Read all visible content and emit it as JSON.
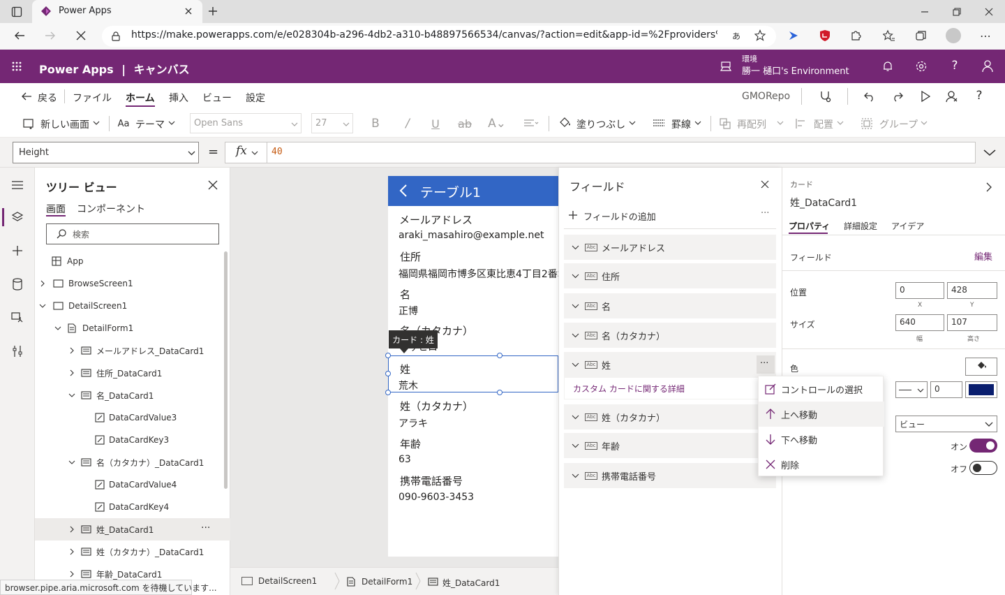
{
  "browser": {
    "tab_title": "Power Apps",
    "url": "https://make.powerapps.com/e/e028304b-a296-4db2-a310-b48897566534/canvas/?action=edit&app-id=%2Fproviders%2FMicrosoft....",
    "status": "browser.pipe.aria.microsoft.com を待機しています..."
  },
  "app_header": {
    "brand": "Power Apps",
    "separator": "|",
    "section": "キャンバス",
    "env_label": "環境",
    "env_name": "勝一 樋口's Environment"
  },
  "menu": {
    "back": "戻る",
    "items": [
      "ファイル",
      "ホーム",
      "挿入",
      "ビュー",
      "設定"
    ],
    "app_name": "GMORepo"
  },
  "ribbon": {
    "new_screen": "新しい画面",
    "theme": "テーマ",
    "font": "Open Sans",
    "font_size": "27",
    "fill": "塗りつぶし",
    "border": "罫線",
    "reorder": "再配列",
    "align": "配置",
    "group": "グループ"
  },
  "formula": {
    "property": "Height",
    "equals": "=",
    "fx": "fx",
    "value": "40"
  },
  "tree": {
    "title": "ツリー ビュー",
    "tab_screens": "画面",
    "tab_components": "コンポーネント",
    "search_placeholder": "検索",
    "items": [
      "App",
      "BrowseScreen1",
      "DetailScreen1",
      "DetailForm1",
      "メールアドレス_DataCard1",
      "住所_DataCard1",
      "名_DataCard1",
      "DataCardValue3",
      "DataCardKey3",
      "名（カタカナ）_DataCard1",
      "DataCardValue4",
      "DataCardKey4",
      "姓_DataCard1",
      "姓（カタカナ）_DataCard1",
      "年齢_DataCard1"
    ],
    "more": "···"
  },
  "screen": {
    "title": "テーブル1",
    "fields": [
      {
        "label": "メールアドレス",
        "value": "araki_masahiro@example.net"
      },
      {
        "label": "住所",
        "value": "福岡県福岡市博多区東比恵4丁目2番地"
      },
      {
        "label": "名",
        "value": "正博"
      },
      {
        "label": "名（カタカナ）",
        "value": "マサヒロ"
      },
      {
        "label": "姓",
        "value": "荒木"
      },
      {
        "label": "姓（カタカナ）",
        "value": "アラキ"
      },
      {
        "label": "年齢",
        "value": "63"
      },
      {
        "label": "携帯電話番号",
        "value": "090-9603-3453"
      }
    ],
    "tooltip": "カード : 姓"
  },
  "breadcrumb": {
    "items": [
      "DetailScreen1",
      "DetailForm1",
      "姓_DataCard1"
    ]
  },
  "fields_panel": {
    "title": "フィールド",
    "add": "フィールドの追加",
    "more": "···",
    "fields": [
      "メールアドレス",
      "住所",
      "名",
      "名（カタカナ）",
      "姓",
      "姓（カタカナ）",
      "年齢",
      "携帯電話番号"
    ],
    "custom_link": "カスタム カードに関する詳細"
  },
  "context_menu": {
    "items": [
      "コントロールの選択",
      "上へ移動",
      "下へ移動",
      "削除"
    ]
  },
  "properties": {
    "type": "カード",
    "name": "姓_DataCard1",
    "tabs": [
      "プロパティ",
      "詳細設定",
      "アイデア"
    ],
    "field_label": "フィールド",
    "edit": "編集",
    "position_label": "位置",
    "x": "0",
    "y": "428",
    "x_label": "X",
    "y_label": "Y",
    "size_label": "サイズ",
    "width": "640",
    "height": "107",
    "width_label": "幅",
    "height_label": "高さ",
    "color_label": "色",
    "border_width": "0",
    "border_color": "#0a1e6e",
    "display_mode": "ビュー",
    "on_label": "オン",
    "off_label": "オフ"
  },
  "colors": {
    "brand_purple": "#742774",
    "screen_header": "#3266c5"
  }
}
